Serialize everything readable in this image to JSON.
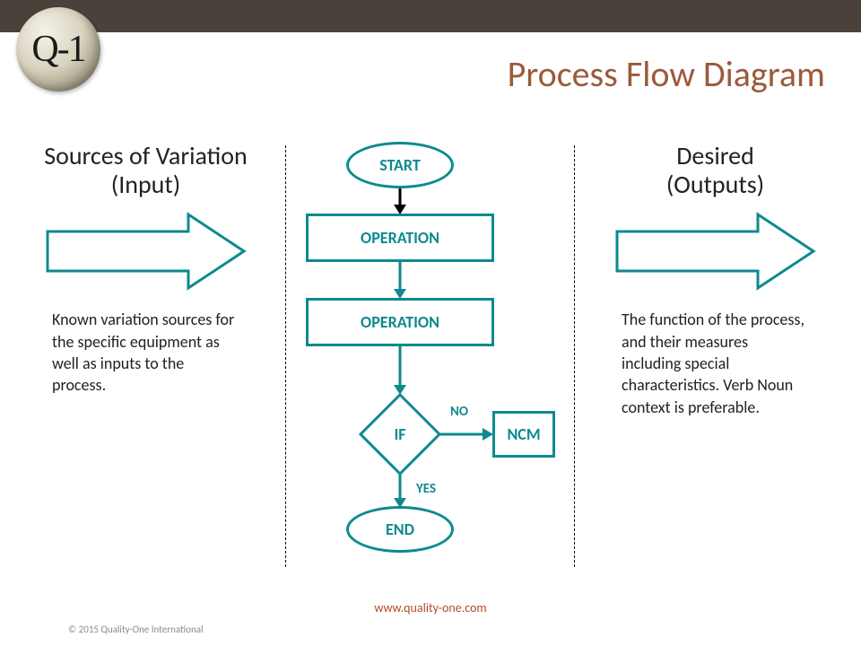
{
  "brand": {
    "logo_text": "Q-1"
  },
  "title": "Process Flow Diagram",
  "colors": {
    "accent": "#0d8a8f",
    "title": "#9b5a3c",
    "topbar": "#4a423a"
  },
  "left": {
    "heading_line1": "Sources of Variation",
    "heading_line2": "(Input)",
    "body": "Known variation sources for the specific equipment as well as inputs to the process."
  },
  "right": {
    "heading_line1": "Desired",
    "heading_line2": "(Outputs)",
    "body": "The function of the process, and their measures including special characteristics. Verb Noun context is preferable."
  },
  "flow": {
    "start": "START",
    "op1": "OPERATION",
    "op2": "OPERATION",
    "decision": "IF",
    "decision_no": "NO",
    "decision_yes": "YES",
    "ncm": "NCM",
    "end": "END"
  },
  "footer": {
    "url": "www.quality-one.com",
    "copyright": "© 2015 Quality-One International"
  }
}
